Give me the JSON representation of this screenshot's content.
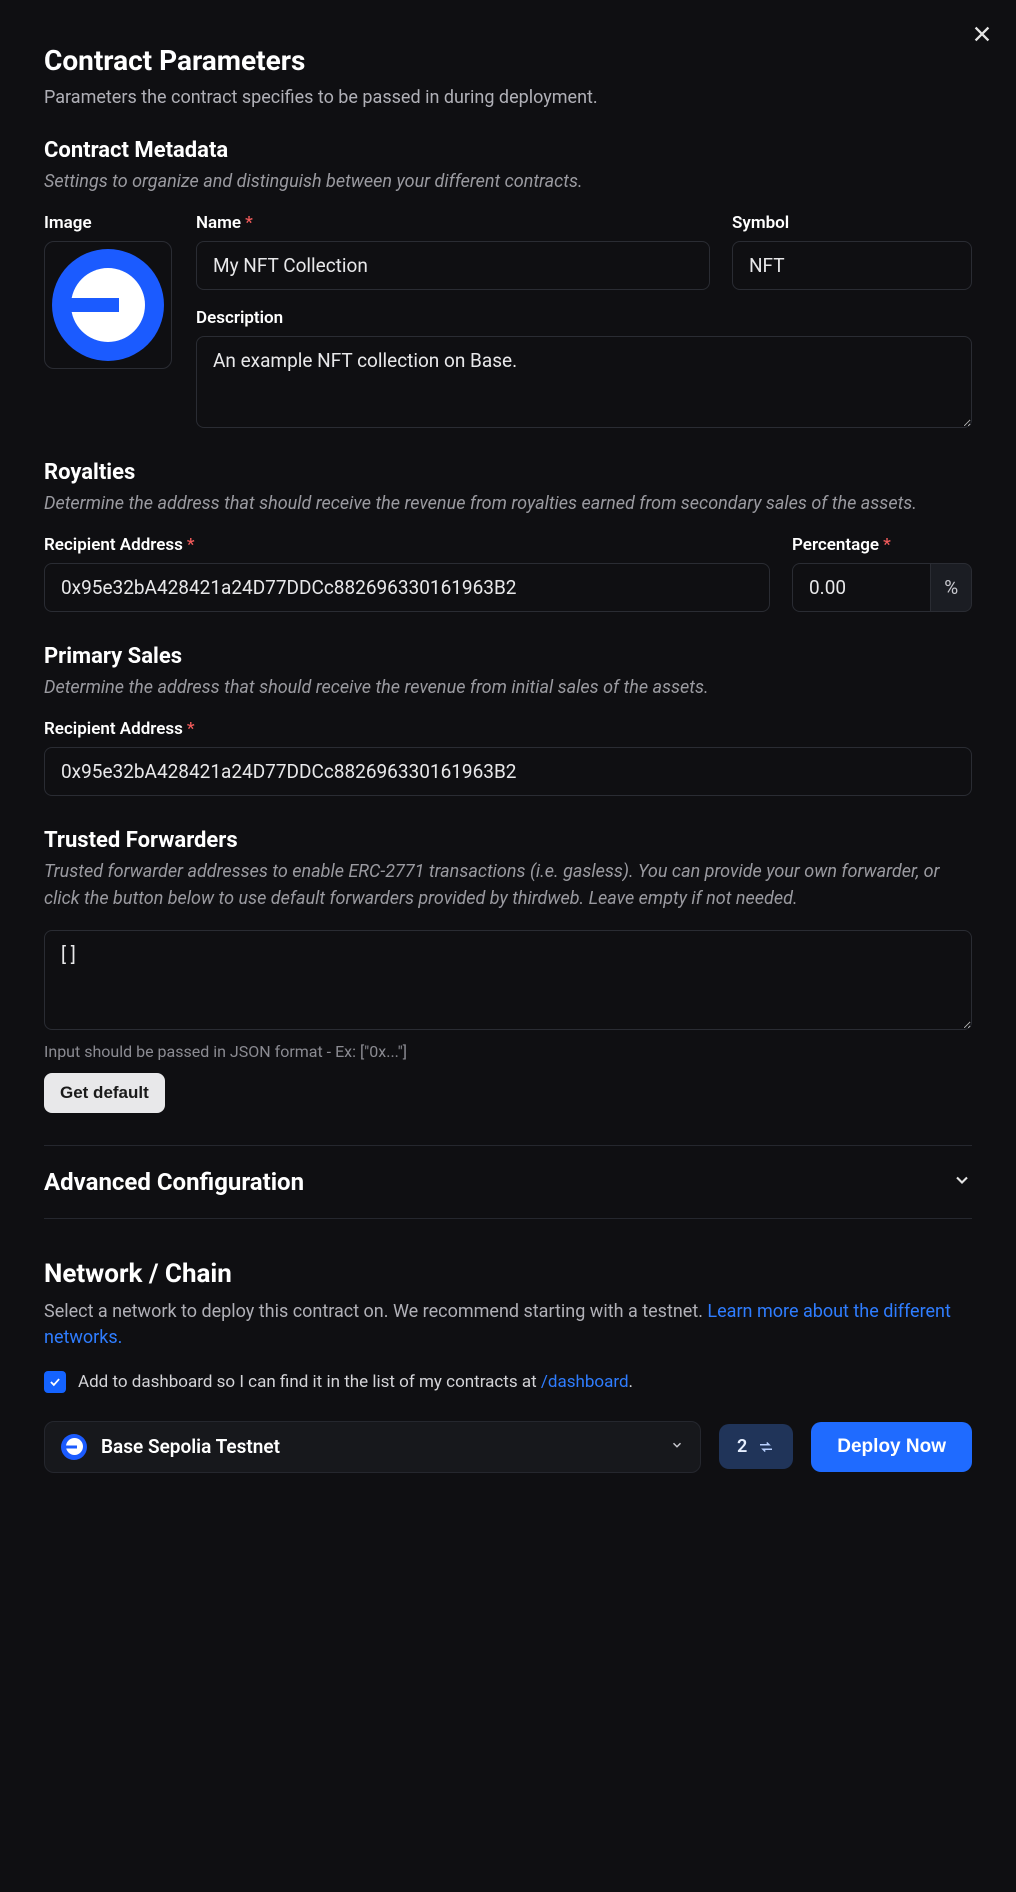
{
  "header": {
    "title": "Contract Parameters",
    "subtitle": "Parameters the contract specifies to be passed in during deployment."
  },
  "metadata": {
    "title": "Contract Metadata",
    "subtitle": "Settings to organize and distinguish between your different contracts.",
    "image_label": "Image",
    "name_label": "Name",
    "name_value": "My NFT Collection",
    "symbol_label": "Symbol",
    "symbol_value": "NFT",
    "description_label": "Description",
    "description_value": "An example NFT collection on Base."
  },
  "royalties": {
    "title": "Royalties",
    "subtitle": "Determine the address that should receive the revenue from royalties earned from secondary sales of the assets.",
    "recipient_label": "Recipient Address",
    "recipient_value": "0x95e32bA428421a24D77DDCc882696330161963B2",
    "percentage_label": "Percentage",
    "percentage_value": "0.00",
    "percentage_suffix": "%"
  },
  "primary": {
    "title": "Primary Sales",
    "subtitle": "Determine the address that should receive the revenue from initial sales of the assets.",
    "recipient_label": "Recipient Address",
    "recipient_value": "0x95e32bA428421a24D77DDCc882696330161963B2"
  },
  "forwarders": {
    "title": "Trusted Forwarders",
    "subtitle": "Trusted forwarder addresses to enable ERC-2771 transactions (i.e. gasless). You can provide your own forwarder, or click the button below to use default forwarders provided by thirdweb. Leave empty if not needed.",
    "value": "[ ]",
    "helper": "Input should be passed in JSON format - Ex: [\"0x...\"]",
    "button": "Get default"
  },
  "advanced": {
    "title": "Advanced Configuration"
  },
  "network": {
    "title": "Network / Chain",
    "subtitle_prefix": "Select a network to deploy this contract on. We recommend starting with a testnet. ",
    "learn_link": "Learn more about the different networks.",
    "checkbox_label_prefix": "Add to dashboard so I can find it in the list of my contracts at ",
    "dashboard_link": "/dashboard",
    "checkbox_label_suffix": ".",
    "selected": "Base Sepolia Testnet",
    "tx_count": "2",
    "deploy_label": "Deploy Now"
  }
}
